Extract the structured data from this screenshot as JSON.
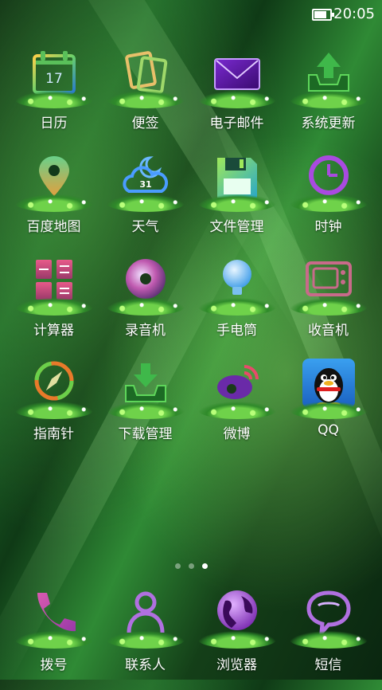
{
  "status_bar": {
    "time": "20:05",
    "battery_level": 0.9,
    "battery_icon": "battery-icon"
  },
  "apps": [
    {
      "name": "calendar",
      "label": "日历",
      "icon": "calendar-icon",
      "badge": "17"
    },
    {
      "name": "notes",
      "label": "便签",
      "icon": "notes-icon"
    },
    {
      "name": "email",
      "label": "电子邮件",
      "icon": "mail-icon"
    },
    {
      "name": "system-update",
      "label": "系统更新",
      "icon": "update-arrow-icon"
    },
    {
      "name": "baidu-map",
      "label": "百度地图",
      "icon": "map-pin-icon"
    },
    {
      "name": "weather",
      "label": "天气",
      "icon": "weather-cloud-icon",
      "badge": "31"
    },
    {
      "name": "file-manager",
      "label": "文件管理",
      "icon": "floppy-disk-icon"
    },
    {
      "name": "clock",
      "label": "时钟",
      "icon": "clock-icon"
    },
    {
      "name": "calculator",
      "label": "计算器",
      "icon": "calculator-icon"
    },
    {
      "name": "recorder",
      "label": "录音机",
      "icon": "disc-icon"
    },
    {
      "name": "flashlight",
      "label": "手电筒",
      "icon": "light-bulb-icon"
    },
    {
      "name": "radio",
      "label": "收音机",
      "icon": "radio-tv-icon"
    },
    {
      "name": "compass",
      "label": "指南针",
      "icon": "compass-icon"
    },
    {
      "name": "download-manager",
      "label": "下载管理",
      "icon": "download-icon"
    },
    {
      "name": "weibo",
      "label": "微博",
      "icon": "weibo-icon"
    },
    {
      "name": "qq",
      "label": "QQ",
      "icon": "qq-penguin-icon"
    }
  ],
  "page_indicator": {
    "pages": 3,
    "current": 3
  },
  "dock": [
    {
      "name": "dialer",
      "label": "拨号",
      "icon": "phone-icon"
    },
    {
      "name": "contacts",
      "label": "联系人",
      "icon": "contact-person-icon"
    },
    {
      "name": "browser",
      "label": "浏览器",
      "icon": "globe-icon"
    },
    {
      "name": "messages",
      "label": "短信",
      "icon": "speech-bubble-icon"
    }
  ],
  "colors": {
    "wallpaper_dark": "#0c2a12",
    "wallpaper_light": "#2f8a35",
    "grass": "#6fd24a",
    "text": "#ffffff"
  }
}
